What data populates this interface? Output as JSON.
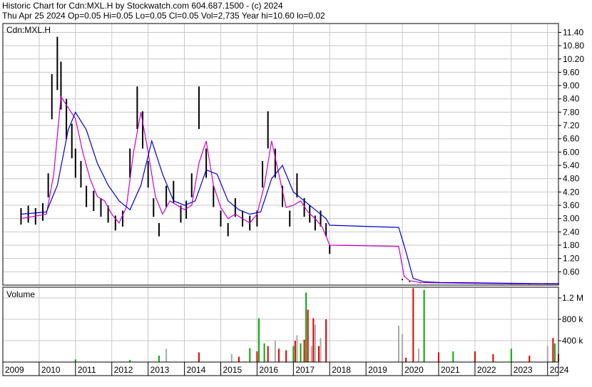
{
  "header": {
    "line1": "Historic Chart for Cdn:MXL.H by Stockwatch.com 604.687.1500 - (c) 2024",
    "line2": "Thu Apr 25 2024  Op=0.05  Hi=0.05  Lo=0.05  Cl=0.05  Vol=2,735  Year hi=10.60  lo=0.02"
  },
  "colors": {
    "background": "#ffffff",
    "grid": "#c8c8c8",
    "price_bars": "#000000",
    "ma_short": "#cc00cc",
    "ma_long": "#0000cc",
    "vol_up": "#00aa00",
    "vol_down": "#dd0000",
    "vol_flat": "#aaaaaa"
  },
  "chart_data": [
    {
      "type": "line",
      "title": "Cdn:MXL.H",
      "ylim": [
        0,
        11.8
      ],
      "yticks": [
        "0.60",
        "1.20",
        "1.80",
        "2.40",
        "3.00",
        "3.60",
        "4.20",
        "4.80",
        "5.40",
        "6.00",
        "6.60",
        "7.20",
        "7.80",
        "8.40",
        "9.00",
        "9.60",
        "10.20",
        "10.80",
        "11.40"
      ],
      "xlabels": [
        "2009",
        "2010",
        "2011",
        "2012",
        "2013",
        "2014",
        "2015",
        "2016",
        "2017",
        "2018",
        "2019",
        "2020",
        "2021",
        "2022",
        "2023",
        "2024"
      ],
      "grid": true,
      "series": [
        {
          "style": "price-bars",
          "x": [
            2009.5,
            2009.7,
            2009.9,
            2010.1,
            2010.25,
            2010.35,
            2010.5,
            2010.6,
            2010.75,
            2010.9,
            2011.0,
            2011.15,
            2011.3,
            2011.5,
            2011.7,
            2011.9,
            2012.1,
            2012.3,
            2012.5,
            2012.7,
            2012.85,
            2013.0,
            2013.15,
            2013.3,
            2013.5,
            2013.7,
            2013.9,
            2014.05,
            2014.2,
            2014.4,
            2014.6,
            2014.8,
            2015.0,
            2015.2,
            2015.4,
            2015.6,
            2015.8,
            2016.0,
            2016.15,
            2016.3,
            2016.5,
            2016.7,
            2016.9,
            2017.1,
            2017.3,
            2017.45,
            2017.6,
            2017.75,
            2017.9,
            2018.0,
            2020.0,
            2020.2,
            2020.5,
            2021.0,
            2021.5,
            2022.0,
            2022.5,
            2023.0,
            2023.5,
            2024.0,
            2024.3
          ],
          "y": [
            3.1,
            3.2,
            3.1,
            3.3,
            4.5,
            8.5,
            10.0,
            9.0,
            7.5,
            6.5,
            5.5,
            5.0,
            4.0,
            3.8,
            3.5,
            3.2,
            2.8,
            3.0,
            5.5,
            8.0,
            7.0,
            5.0,
            3.5,
            2.5,
            4.0,
            4.2,
            3.2,
            3.4,
            4.5,
            8.0,
            5.5,
            4.0,
            3.0,
            2.5,
            3.5,
            3.0,
            2.8,
            3.0,
            5.0,
            7.0,
            5.5,
            4.0,
            3.0,
            4.5,
            3.5,
            3.2,
            2.8,
            3.0,
            2.5,
            1.6,
            0.25,
            0.15,
            0.1,
            0.12,
            0.1,
            0.08,
            0.07,
            0.06,
            0.05,
            0.05,
            0.05
          ]
        },
        {
          "name": "",
          "style": "ma-short",
          "x": [
            2009.5,
            2010.2,
            2010.4,
            2010.6,
            2010.8,
            2011.0,
            2011.2,
            2011.4,
            2011.6,
            2011.8,
            2012.0,
            2012.2,
            2012.4,
            2012.6,
            2012.8,
            2013.0,
            2013.2,
            2013.4,
            2013.6,
            2013.8,
            2014.0,
            2014.2,
            2014.4,
            2014.6,
            2014.8,
            2015.0,
            2015.2,
            2015.4,
            2015.6,
            2015.8,
            2016.0,
            2016.2,
            2016.4,
            2016.6,
            2016.8,
            2017.0,
            2017.2,
            2017.4,
            2017.6,
            2017.8,
            2018.0,
            2019.9,
            2020.05,
            2020.2,
            2020.5,
            2021.0,
            2022.0,
            2023.0,
            2024.3
          ],
          "y": [
            3.0,
            3.2,
            5.0,
            8.5,
            8.0,
            7.5,
            6.0,
            4.8,
            4.0,
            3.8,
            3.2,
            2.8,
            3.5,
            6.0,
            7.8,
            6.0,
            4.0,
            3.2,
            3.8,
            3.6,
            3.4,
            3.6,
            5.5,
            6.5,
            4.5,
            3.5,
            3.0,
            3.2,
            3.0,
            2.8,
            3.2,
            4.5,
            6.5,
            5.0,
            3.5,
            3.6,
            3.8,
            3.3,
            3.0,
            2.6,
            1.8,
            1.75,
            0.4,
            0.2,
            0.12,
            0.1,
            0.08,
            0.06,
            0.05
          ]
        },
        {
          "name": "",
          "style": "ma-long",
          "x": [
            2009.5,
            2010.2,
            2010.5,
            2010.8,
            2011.0,
            2011.3,
            2011.6,
            2011.9,
            2012.2,
            2012.5,
            2012.8,
            2013.1,
            2013.4,
            2013.7,
            2014.0,
            2014.3,
            2014.6,
            2014.9,
            2015.2,
            2015.5,
            2015.8,
            2016.1,
            2016.4,
            2016.7,
            2017.0,
            2017.3,
            2017.6,
            2017.9,
            2018.0,
            2019.9,
            2020.1,
            2020.3,
            2020.6,
            2021.0,
            2022.0,
            2023.0,
            2024.3
          ],
          "y": [
            3.2,
            3.3,
            4.5,
            7.0,
            7.8,
            7.0,
            5.5,
            4.5,
            3.8,
            3.4,
            4.5,
            6.5,
            5.0,
            3.8,
            3.6,
            3.8,
            5.2,
            5.0,
            3.8,
            3.4,
            3.2,
            3.3,
            4.8,
            5.4,
            4.2,
            3.8,
            3.4,
            3.0,
            2.7,
            2.6,
            1.5,
            0.3,
            0.15,
            0.12,
            0.1,
            0.08,
            0.06
          ]
        }
      ]
    },
    {
      "type": "bar",
      "title": "Volume",
      "ylim": [
        0,
        1400000
      ],
      "yticks": [
        "400 k",
        "800 k",
        "1.2 M"
      ],
      "grid": true,
      "series": [
        {
          "style": "volume",
          "x": [
            2011.0,
            2012.5,
            2013.3,
            2013.5,
            2014.4,
            2015.3,
            2015.5,
            2015.8,
            2016.0,
            2016.05,
            2016.2,
            2016.3,
            2016.5,
            2016.6,
            2016.8,
            2017.0,
            2017.05,
            2017.1,
            2017.2,
            2017.3,
            2017.35,
            2017.4,
            2017.5,
            2017.55,
            2017.6,
            2017.7,
            2017.75,
            2017.9,
            2019.9,
            2020.0,
            2020.1,
            2020.3,
            2020.45,
            2020.6,
            2021.0,
            2021.4,
            2022.0,
            2022.5,
            2023.0,
            2023.5,
            2024.0,
            2024.15,
            2024.2,
            2024.3
          ],
          "y": [
            50000,
            40000,
            120000,
            250000,
            180000,
            150000,
            100000,
            260000,
            200000,
            820000,
            350000,
            300000,
            400000,
            250000,
            220000,
            300000,
            400000,
            500000,
            350000,
            420000,
            1300000,
            980000,
            300000,
            820000,
            700000,
            300000,
            450000,
            800000,
            680000,
            520000,
            80000,
            1380000,
            250000,
            1350000,
            180000,
            200000,
            200000,
            150000,
            250000,
            120000,
            300000,
            450000,
            350000,
            150000
          ],
          "colors": [
            "green",
            "green",
            "green",
            "gray",
            "red",
            "gray",
            "red",
            "green",
            "red",
            "green",
            "green",
            "red",
            "gray",
            "red",
            "red",
            "green",
            "red",
            "gray",
            "green",
            "red",
            "green",
            "red",
            "gray",
            "red",
            "gray",
            "red",
            "gray",
            "red",
            "gray",
            "gray",
            "red",
            "red",
            "gray",
            "green",
            "red",
            "green",
            "red",
            "red",
            "green",
            "red",
            "gray",
            "red",
            "green",
            "red"
          ]
        }
      ]
    }
  ]
}
